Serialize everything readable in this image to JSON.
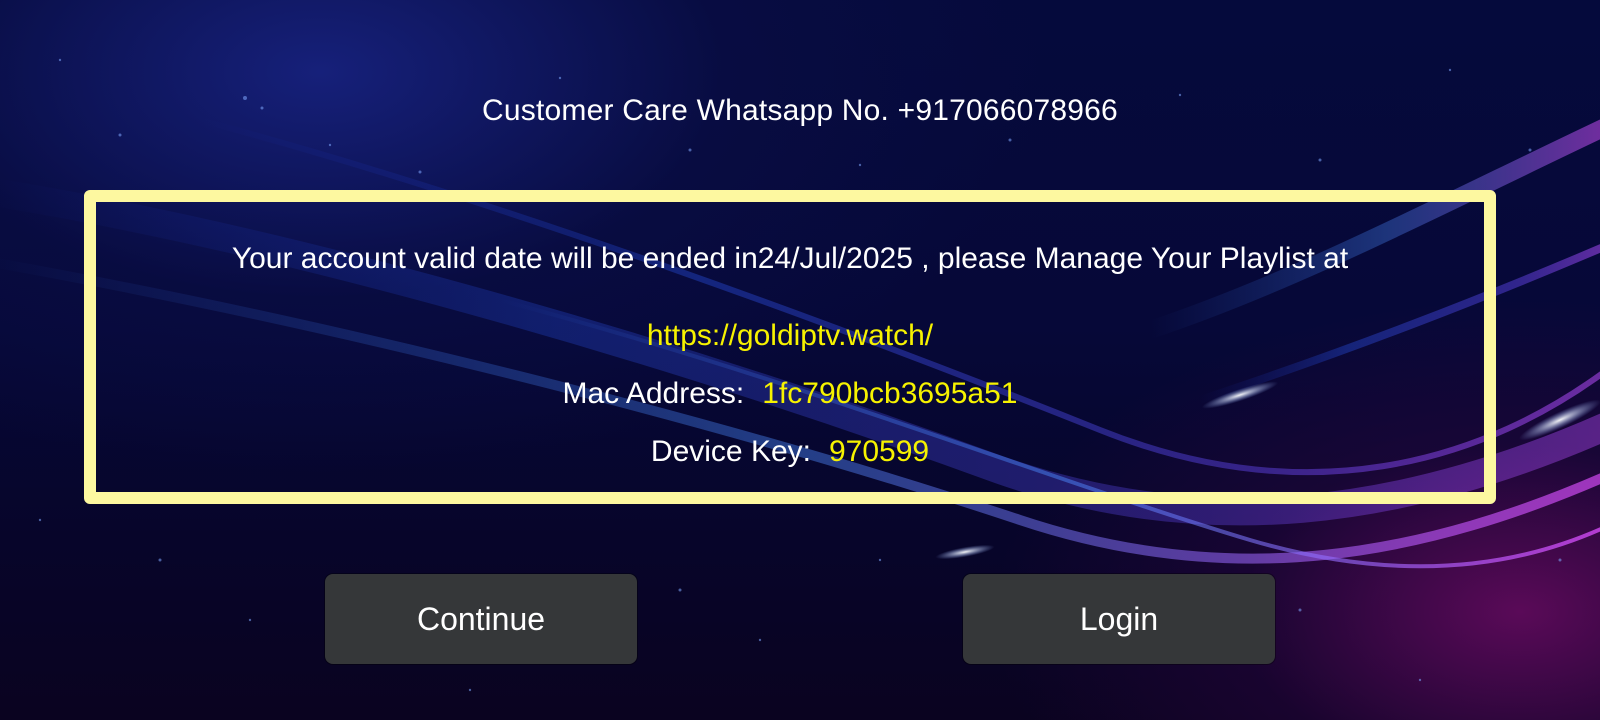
{
  "header": {
    "customer_care": "Customer Care Whatsapp No. +917066078966"
  },
  "info_box": {
    "message": "Your account valid date will be ended in24/Jul/2025 , please Manage Your Playlist at",
    "url": "https://goldiptv.watch/",
    "mac_label": "Mac Address:",
    "mac_value": "1fc790bcb3695a51",
    "device_key_label": "Device Key:",
    "device_key_value": "970599"
  },
  "buttons": {
    "continue_label": "Continue",
    "login_label": "Login"
  },
  "colors": {
    "box_border": "#fdf8a0",
    "highlight_text": "#f6f200",
    "button_bg": "#353739",
    "background": "#050a3c"
  }
}
